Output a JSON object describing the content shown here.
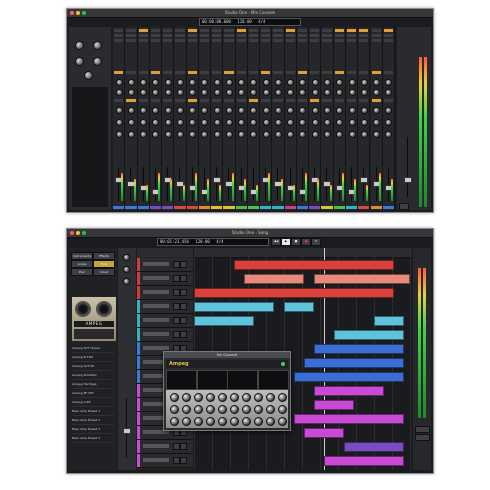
{
  "top_window": {
    "title": "Studio One - Mix Console",
    "transport": [
      "00:00:00.000",
      "120.00",
      "4/4"
    ],
    "channel_colors": [
      "#3a7bd5",
      "#3a7bd5",
      "#3a7bd5",
      "#7a4cc2",
      "#7a4cc2",
      "#d54a3a",
      "#d54a3a",
      "#e08a2c",
      "#e0c22c",
      "#e0c22c",
      "#4ac24a",
      "#4ac24a",
      "#2cb4c8",
      "#2cb4c8",
      "#d53a8a",
      "#3a7bd5",
      "#7a4cc2",
      "#e0c22c",
      "#4ac24a",
      "#2cb4c8",
      "#d54a3a",
      "#e08a2c",
      "#3a7bd5"
    ],
    "accent": "#e0a032",
    "channel_count": 23
  },
  "bottom_window": {
    "title": "Studio One - Song",
    "transport": [
      "00:01:23.456",
      "120.00",
      "4/4",
      "PRE"
    ],
    "plugin_title": "Fat Channel",
    "plugin_brand": "Ampeg",
    "amp_brand": "AMPEG",
    "browser_buttons": [
      "Instruments",
      "Effects",
      "Loops",
      "Files",
      "Pool",
      "Cloud"
    ],
    "browser_items": [
      "Ampeg SVT Classic",
      "Ampeg B-15N",
      "Ampeg SVT-VR",
      "Ampeg Portaflex",
      "Ampeg Heritage",
      "Ampeg PF-50T",
      "Ampeg V-4B",
      "Bass Amp Preset 1",
      "Bass Amp Preset 2",
      "Bass Amp Preset 3",
      "Bass Amp Preset 4"
    ],
    "track_colors": [
      "#d53a3a",
      "#d53a3a",
      "#d53a3a",
      "#2cb4c8",
      "#2cb4c8",
      "#2cb4c8",
      "#3a7bd5",
      "#3a7bd5",
      "#3a7bd5",
      "#c84ad5",
      "#c84ad5",
      "#c84ad5",
      "#c84ad5",
      "#c84ad5",
      "#c84ad5"
    ],
    "clip_colors": {
      "red": "#d8423a",
      "salmon": "#e78a7c",
      "cyan": "#5fc3dc",
      "blue": "#3a6ed5",
      "magenta": "#c84ad5",
      "purple": "#7a4cc2"
    }
  }
}
